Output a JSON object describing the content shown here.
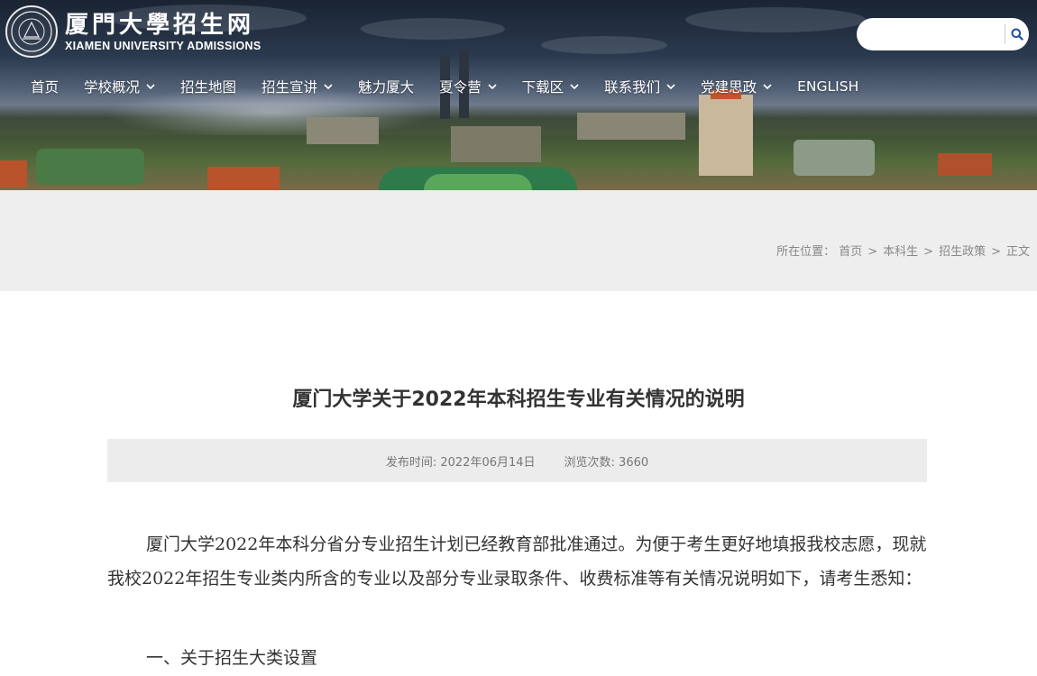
{
  "header": {
    "logo_cn": "厦門大學招生网",
    "logo_en": "XIAMEN UNIVERSITY ADMISSIONS",
    "search_placeholder": "",
    "search_icon": "search-icon"
  },
  "nav": {
    "items": [
      {
        "label": "首页",
        "dropdown": false
      },
      {
        "label": "学校概况",
        "dropdown": true
      },
      {
        "label": "招生地图",
        "dropdown": false
      },
      {
        "label": "招生宣讲",
        "dropdown": true
      },
      {
        "label": "魅力厦大",
        "dropdown": false
      },
      {
        "label": "夏令营",
        "dropdown": true
      },
      {
        "label": "下载区",
        "dropdown": true
      },
      {
        "label": "联系我们",
        "dropdown": true
      },
      {
        "label": "党建思政",
        "dropdown": true
      },
      {
        "label": "ENGLISH",
        "dropdown": false
      }
    ]
  },
  "breadcrumb": {
    "prefix": "所在位置：",
    "items": [
      "首页",
      "本科生",
      "招生政策",
      "正文"
    ],
    "separator": ">"
  },
  "article": {
    "title": "厦门大学关于2022年本科招生专业有关情况的说明",
    "published": "发布时间: 2022年06月14日",
    "views": "浏览次数: 3660",
    "paragraph": "厦门大学2022年本科分省分专业招生计划已经教育部批准通过。为便于考生更好地填报我校志愿，现就我校2022年招生专业类内所含的专业以及部分专业录取条件、收费标准等有关情况说明如下，请考生悉知：",
    "section_heading": "一、关于招生大类设置"
  },
  "colors": {
    "crumb_band": "#eeeeee",
    "meta_band": "#ececec",
    "text": "#333333",
    "nav_text": "#ffffff"
  }
}
